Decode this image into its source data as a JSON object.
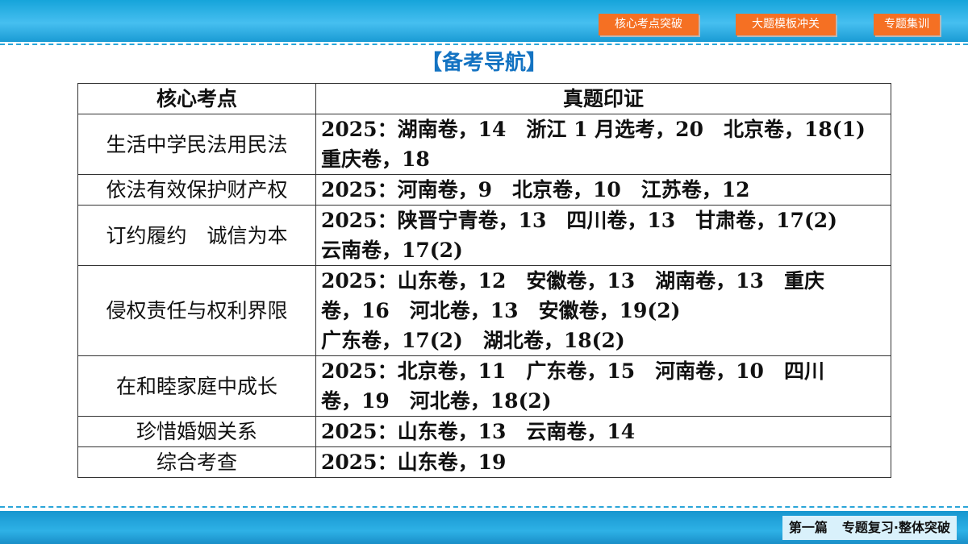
{
  "nav": {
    "buttons": [
      "核心考点突破",
      "大题模板冲关",
      "专题集训"
    ]
  },
  "title": "【备考导航】",
  "table": {
    "headers": [
      "核心考点",
      "真题印证"
    ],
    "rows": [
      {
        "topic": "生活中学民法用民法",
        "lines": [
          "2025：湖南卷，14　浙江 1 月选考，20　北京卷，18(1)",
          "重庆卷，18"
        ]
      },
      {
        "topic": "依法有效保护财产权",
        "lines": [
          "2025：河南卷，9　北京卷，10　江苏卷，12"
        ]
      },
      {
        "topic": "订约履约　诚信为本",
        "lines": [
          "2025：陕晋宁青卷，13　四川卷，13　甘肃卷，17(2)",
          "云南卷，17(2)"
        ]
      },
      {
        "topic": "侵权责任与权利界限",
        "lines": [
          "2025：山东卷，12　安徽卷，13　湖南卷，13　重庆",
          "卷，16　河北卷，13　安徽卷，19(2)",
          "广东卷，17(2)　湖北卷，18(2)"
        ]
      },
      {
        "topic": "在和睦家庭中成长",
        "lines": [
          "2025：北京卷，11　广东卷，15　河南卷，10　四川",
          "卷，19　河北卷，18(2)"
        ]
      },
      {
        "topic": "珍惜婚姻关系",
        "lines": [
          "2025：山东卷，13　云南卷，14"
        ]
      },
      {
        "topic": "综合考查",
        "lines": [
          "2025：山东卷，19"
        ]
      }
    ]
  },
  "footer": {
    "part": "第一篇",
    "section": "专题复习·整体突破"
  },
  "colors": {
    "accent_button": "#f57023",
    "title": "#1473c2",
    "bar": "#1ea8de"
  }
}
